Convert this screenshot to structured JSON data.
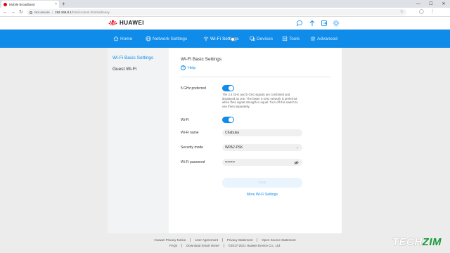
{
  "browser": {
    "tab_title": "Mobile Broadband",
    "tab_close": "×",
    "new_tab": "+",
    "not_secure": "Not secure",
    "url_host": "192.168.8.1",
    "url_path": "/html/content.html#wifieasy",
    "win_min": "—",
    "win_max": "☐",
    "win_close": "✕"
  },
  "brand": {
    "name": "HUAWEI",
    "color": "#e60012"
  },
  "nav": {
    "accent": "#0f8ce9",
    "items": [
      {
        "label": "Home",
        "icon": "home-icon"
      },
      {
        "label": "Network Settings",
        "icon": "globe-icon"
      },
      {
        "label": "Wi-Fi Settings",
        "icon": "wifi-icon",
        "active": true
      },
      {
        "label": "Devices",
        "icon": "devices-icon"
      },
      {
        "label": "Tools",
        "icon": "tools-icon"
      },
      {
        "label": "Advanced",
        "icon": "gear-icon"
      }
    ]
  },
  "top_icons": [
    "message-icon",
    "upload-icon",
    "logout-icon",
    "sun-icon"
  ],
  "sidebar": {
    "items": [
      {
        "label": "Wi-Fi Basic Settings",
        "active": true
      },
      {
        "label": "Guest Wi-Fi"
      }
    ]
  },
  "main": {
    "title": "Wi-Fi Basic Settings",
    "help": "Help",
    "ghz_label": "5 GHz preferred",
    "ghz_enabled": true,
    "ghz_desc": "The 2.4 GHz and 5 GHz signals are combined and displayed as one. The faster 5 GHz network is preferred when their signal strength is equal. Turn off this switch to use them separately.",
    "wifi_label": "Wi-Fi",
    "wifi_enabled": true,
    "name_label": "Wi-Fi name",
    "name_value": "Chabuka",
    "security_label": "Security mode",
    "security_value": "WPA2-PSK",
    "password_label": "Wi-Fi password",
    "password_value": "••••••••",
    "save": "Save",
    "more": "More Wi-Fi Settings"
  },
  "footer": {
    "row1": [
      "Huawei Privacy Notice",
      "User Agreement",
      "Privacy Statement",
      "Open Source Statement"
    ],
    "row2": [
      "FAQs",
      "Download Smart Home",
      "©2017-2021 Huawei Device Co., Ltd."
    ]
  },
  "watermark": {
    "part1": "TECH",
    "part2": "ZIM"
  }
}
